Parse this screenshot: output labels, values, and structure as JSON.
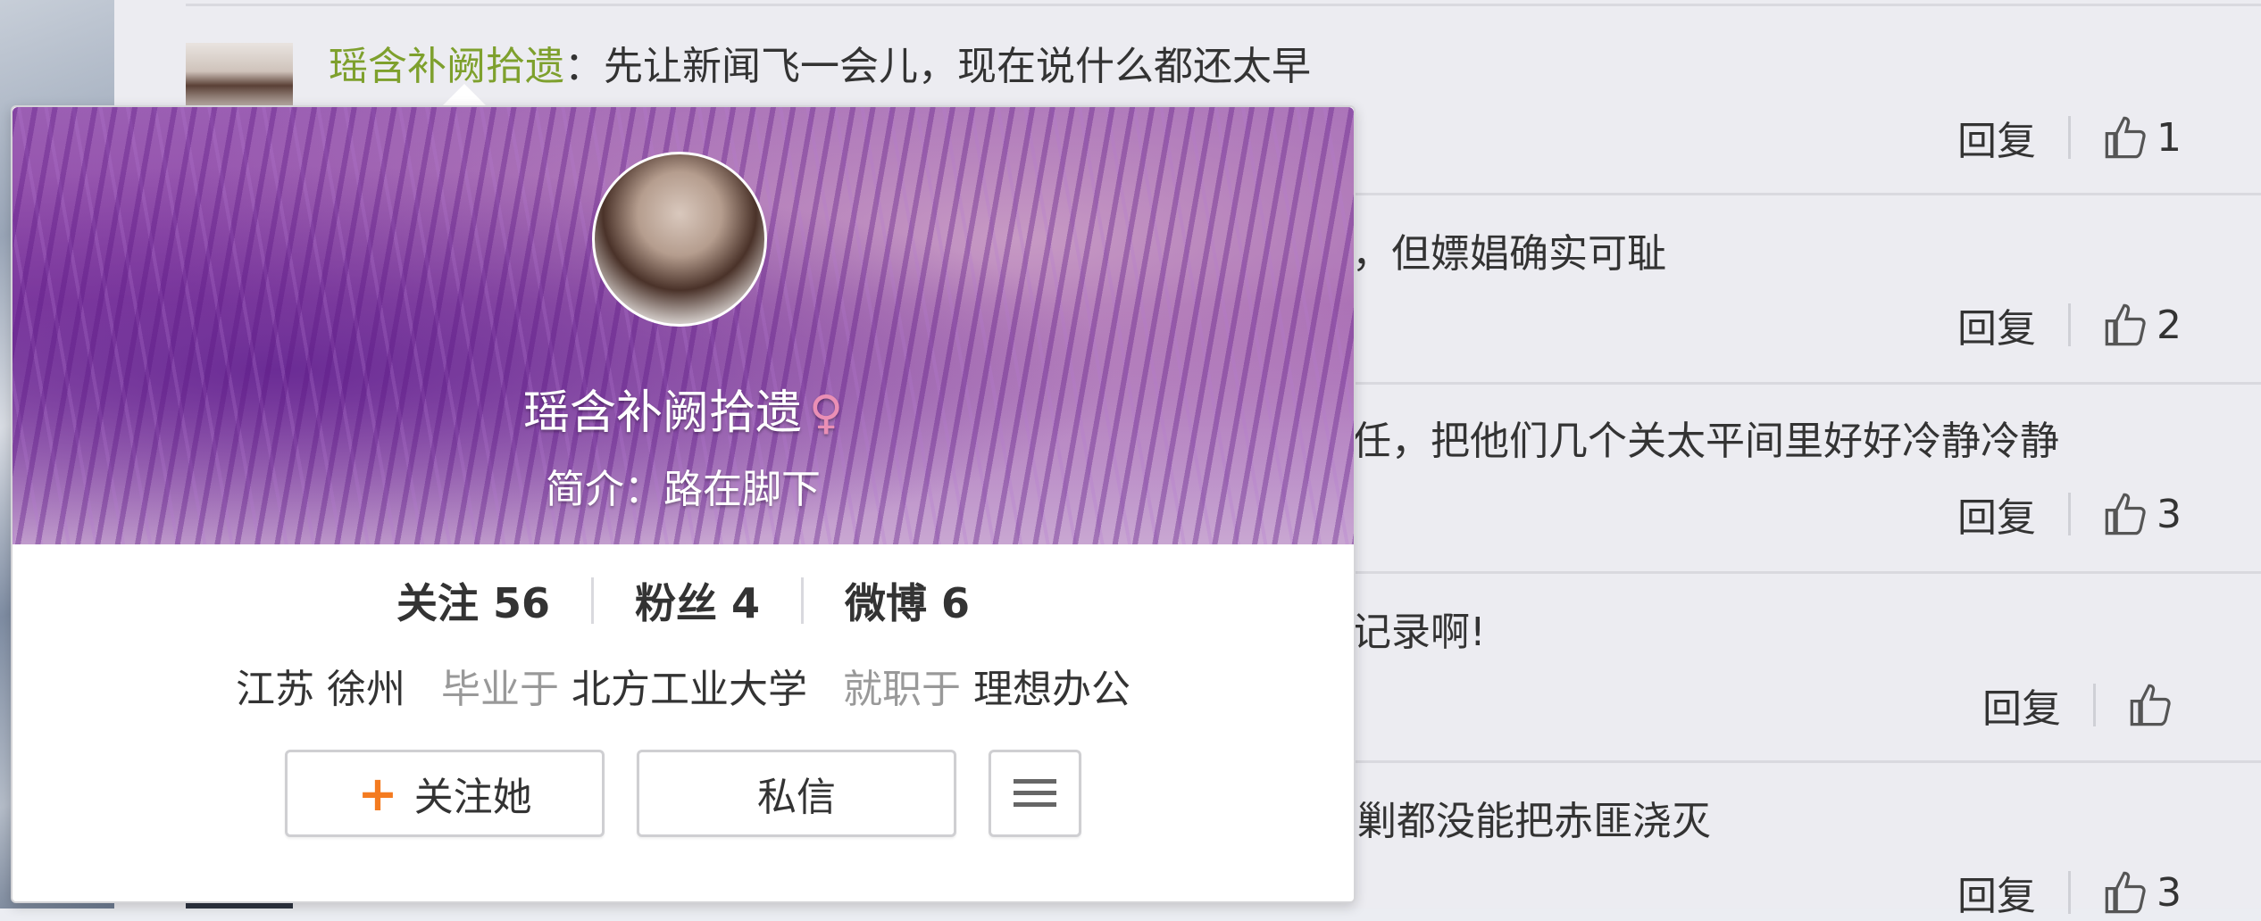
{
  "feed": {
    "comments": [
      {
        "author": "瑶含补阙拾遗",
        "separator": "：",
        "text": "先让新闻飞一会儿，现在说什么都还太早",
        "reply_label": "回复",
        "likes": "1"
      },
      {
        "text": "，但嫖娼确实可耻",
        "reply_label": "回复",
        "likes": "2"
      },
      {
        "text": "任，把他们几个关太平间里好好冷静冷静",
        "reply_label": "回复",
        "likes": "3"
      },
      {
        "text": "记录啊!",
        "reply_label": "回复",
        "likes": ""
      },
      {
        "text": "剿都没能把赤匪浇灭",
        "reply_label": "回复",
        "likes": "3"
      }
    ]
  },
  "profile_card": {
    "name": "瑶含补阙拾遗",
    "gender_symbol": "♀",
    "bio": "简介：路在脚下",
    "stats": {
      "following": "关注 56",
      "followers": "粉丝 4",
      "weibo": "微博 6"
    },
    "location": "江苏 徐州",
    "school_prefix": "毕业于",
    "school": "北方工业大学",
    "work_prefix": "就职于",
    "work": "理想办公",
    "buttons": {
      "follow_plus": "+",
      "follow": "关注她",
      "message": "私信",
      "menu_icon": "menu-icon"
    }
  },
  "colors": {
    "author": "#7ea02d",
    "plus": "#f47b20",
    "female_symbol": "#ea8fb5"
  }
}
